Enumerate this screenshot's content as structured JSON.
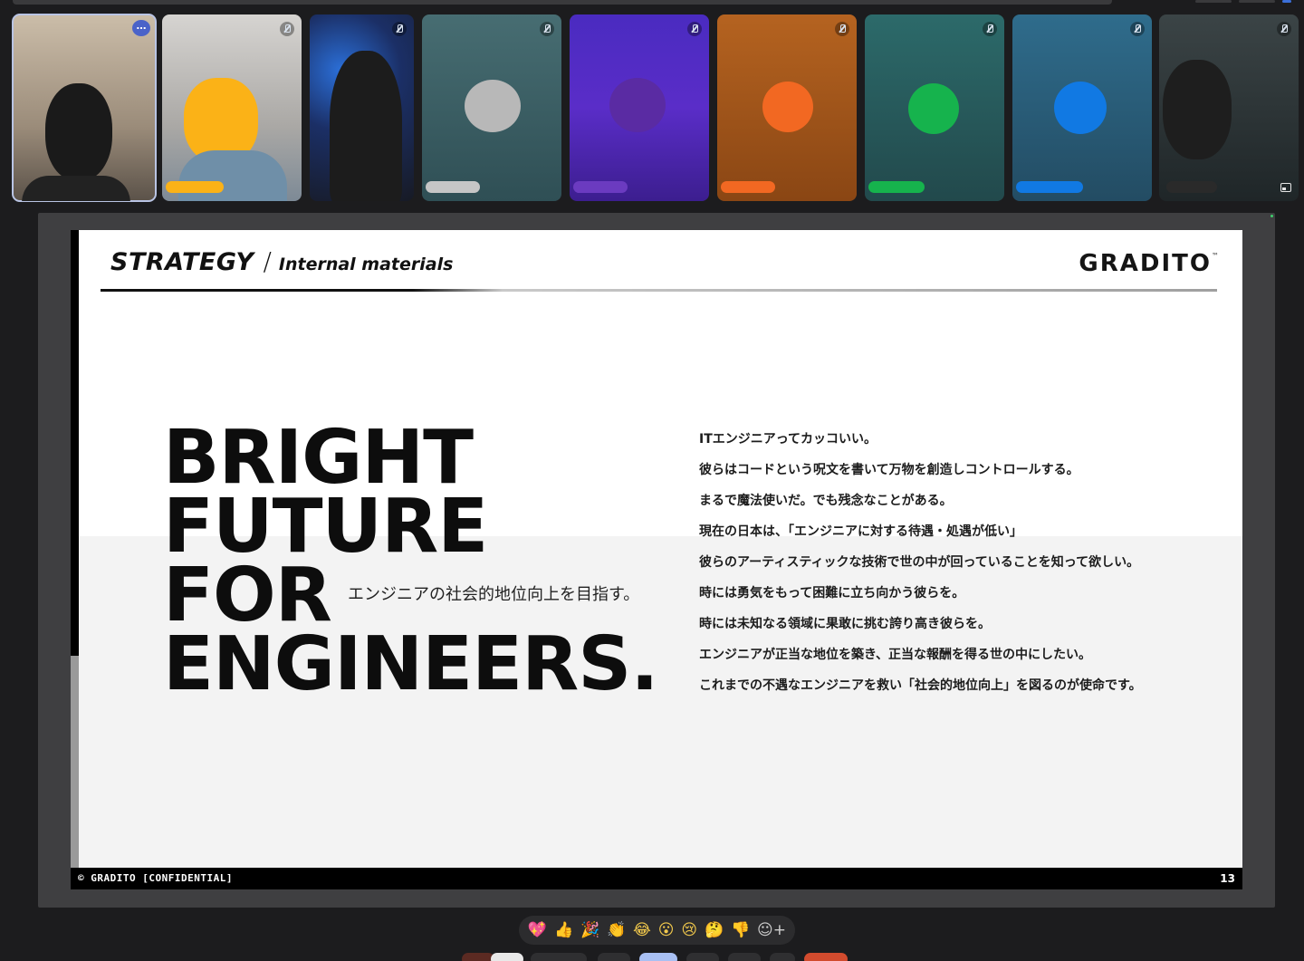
{
  "participants": [
    {
      "name_hidden": true,
      "accent": "#1e1e1e",
      "bg": "#9a8e80",
      "active": true,
      "control": "more-options"
    },
    {
      "name_hidden": true,
      "accent": "#fbb217",
      "bg": "#b7b5b2",
      "control": "mic-off"
    },
    {
      "name_hidden": true,
      "accent": "#1e1e1e",
      "bg": "#1f3567",
      "control": "mic-off"
    },
    {
      "name_hidden": true,
      "accent": "#b8b8b8",
      "bg": "#3c5f63",
      "control": "mic-off"
    },
    {
      "name_hidden": true,
      "accent": "#5a2ba3",
      "bg": "#5a2bc4",
      "control": "mic-off"
    },
    {
      "name_hidden": true,
      "accent": "#f26822",
      "bg": "#9a4f18",
      "control": "mic-off"
    },
    {
      "name_hidden": true,
      "accent": "#16b34d",
      "bg": "#2b5d60",
      "control": "mic-off"
    },
    {
      "name_hidden": true,
      "accent": "#1179e3",
      "bg": "#2f5f7c",
      "control": "mic-off"
    },
    {
      "name_hidden": true,
      "accent": "#1e1e1e",
      "bg": "#2a3133",
      "control": "mic-off"
    }
  ],
  "more_icon": "…",
  "slide": {
    "header_title": "STRATEGY",
    "header_sep": "/",
    "header_subtitle": "Internal materials",
    "brand": "GRADITO",
    "brand_tm": "™",
    "headline": [
      "BRIGHT",
      "FUTURE",
      "FOR",
      "ENGINEERS."
    ],
    "tagline": "エンジニアの社会的地位向上を目指す。",
    "body": [
      "ITエンジニアってカッコいい。",
      "彼らはコードという呪文を書いて万物を創造しコントロールする。",
      "まるで魔法使いだ。でも残念なことがある。",
      "現在の日本は、「エンジニアに対する待遇・処遇が低い」",
      "彼らのアーティスティックな技術で世の中が回っていることを知って欲しい。",
      "時には勇気をもって困難に立ち向かう彼らを。",
      "時には未知なる領域に果敢に挑む誇り高き彼らを。",
      "エンジニアが正当な地位を築き、正当な報酬を得る世の中にしたい。",
      "これまでの不遇なエンジニアを救い「社会的地位向上」を図るのが使命です。"
    ],
    "footer_left": "© GRADITO [CONFIDENTIAL]",
    "page_number": "13"
  },
  "reactions": [
    "💖",
    "👍",
    "🎉",
    "👏",
    "😂",
    "😮",
    "😢",
    "🤔",
    "👎",
    "☺+"
  ],
  "icons": {
    "mic": "mic-off-icon",
    "more": "more-options-icon",
    "pip": "picture-in-picture-icon",
    "add_reaction": "add-reaction-icon"
  }
}
